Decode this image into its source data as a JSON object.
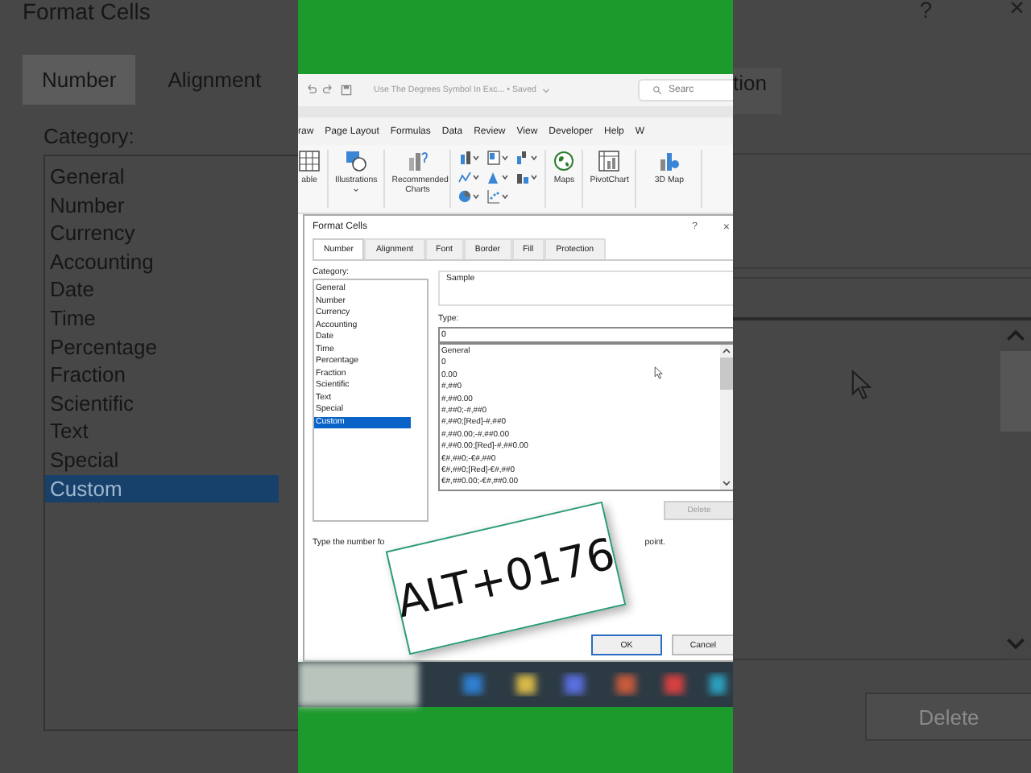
{
  "left_panel": {
    "title": "Format Cells",
    "tabs": [
      {
        "label": "Number",
        "selected": true
      },
      {
        "label": "Alignment",
        "selected": false
      }
    ],
    "category_label": "Category:",
    "categories": [
      {
        "label": "General",
        "selected": false
      },
      {
        "label": "Number",
        "selected": false
      },
      {
        "label": "Currency",
        "selected": false
      },
      {
        "label": "Accounting",
        "selected": false
      },
      {
        "label": "Date",
        "selected": false
      },
      {
        "label": "Time",
        "selected": false
      },
      {
        "label": "Percentage",
        "selected": false
      },
      {
        "label": "Fraction",
        "selected": false
      },
      {
        "label": "Scientific",
        "selected": false
      },
      {
        "label": "Text",
        "selected": false
      },
      {
        "label": "Special",
        "selected": false
      },
      {
        "label": "Custom",
        "selected": true
      }
    ]
  },
  "excel": {
    "document_title": "Use The Degrees Symbol In Exc... • Saved",
    "search_placeholder": "Searc",
    "ribbon_tabs": [
      "raw",
      "Page Layout",
      "Formulas",
      "Data",
      "Review",
      "View",
      "Developer",
      "Help",
      "W"
    ],
    "ribbon_groups": [
      {
        "kind": "table",
        "label": "able"
      },
      {
        "kind": "illustrations",
        "label": "Illustrations"
      },
      {
        "kind": "recommended",
        "label": "Recommended Charts"
      },
      {
        "kind": "gallery"
      },
      {
        "kind": "maps",
        "label": "Maps"
      },
      {
        "kind": "pivot",
        "label": "PivotChart"
      },
      {
        "kind": "map3d",
        "label": "3D Map"
      }
    ]
  },
  "dialog": {
    "title": "Format Cells",
    "help": "?",
    "close": "×",
    "tabs": [
      {
        "label": "Number",
        "selected": true
      },
      {
        "label": "Alignment",
        "selected": false
      },
      {
        "label": "Font",
        "selected": false
      },
      {
        "label": "Border",
        "selected": false
      },
      {
        "label": "Fill",
        "selected": false
      },
      {
        "label": "Protection",
        "selected": false
      }
    ],
    "category_label": "Category:",
    "categories": [
      {
        "label": "General",
        "selected": false
      },
      {
        "label": "Number",
        "selected": false
      },
      {
        "label": "Currency",
        "selected": false
      },
      {
        "label": "Accounting",
        "selected": false
      },
      {
        "label": "Date",
        "selected": false
      },
      {
        "label": "Time",
        "selected": false
      },
      {
        "label": "Percentage",
        "selected": false
      },
      {
        "label": "Fraction",
        "selected": false
      },
      {
        "label": "Scientific",
        "selected": false
      },
      {
        "label": "Text",
        "selected": false
      },
      {
        "label": "Special",
        "selected": false
      },
      {
        "label": "Custom",
        "selected": true
      }
    ],
    "sample_label": "Sample",
    "type_label": "Type:",
    "type_value": "0",
    "formats": [
      "General",
      "0",
      "0.00",
      "#,##0",
      "#,##0.00",
      "#,##0;-#,##0",
      "#,##0;[Red]-#,##0",
      "#,##0.00;-#,##0.00",
      "#,##0.00;[Red]-#,##0.00",
      "€#,##0;-€#,##0",
      "€#,##0;[Red]-€#,##0",
      "€#,##0.00;-€#,##0.00"
    ],
    "delete_button": {
      "label": "Delete",
      "disabled": true
    },
    "hint_start": "Type the number fo",
    "hint_end": "point.",
    "ok": "OK",
    "cancel": "Cancel"
  },
  "sticker": {
    "text": "ALT+0176"
  },
  "right_panel": {
    "help": "?",
    "close": "×",
    "tab_fragment": "tion",
    "delete_button": {
      "label": "Delete",
      "disabled": true
    }
  }
}
